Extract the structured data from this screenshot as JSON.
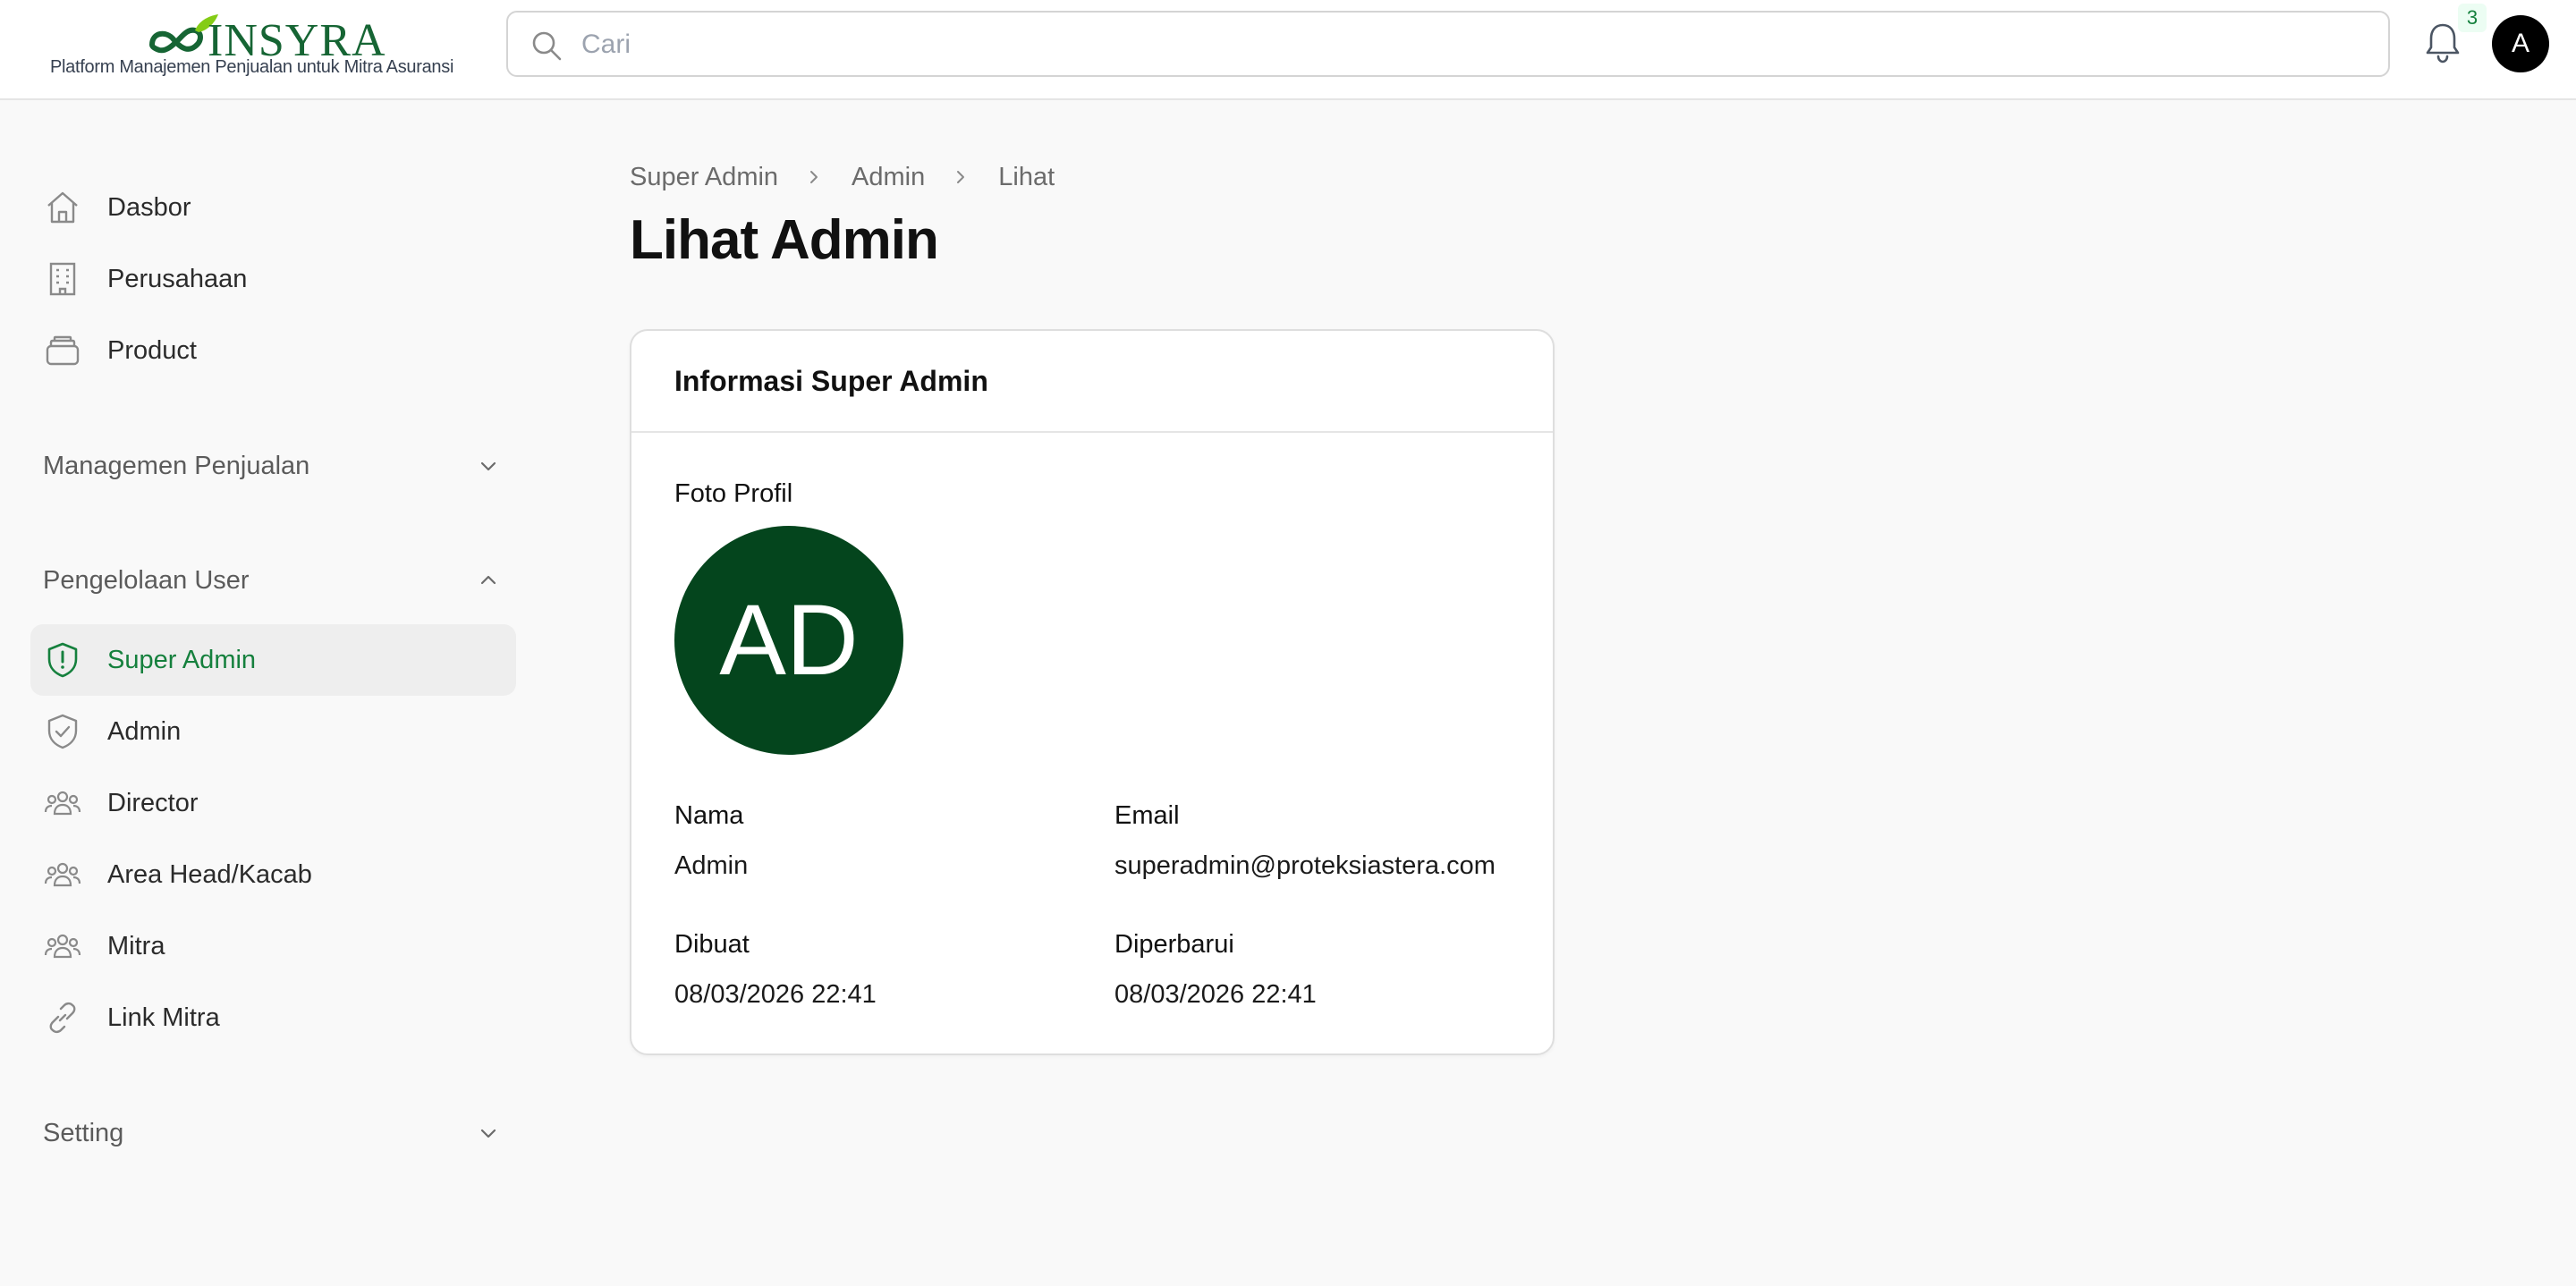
{
  "header": {
    "brand_name": "INSYRA",
    "brand_tagline": "Platform Manajemen Penjualan untuk Mitra Asuransi",
    "search_placeholder": "Cari",
    "notification_count": "3",
    "user_initial": "A",
    "brand_color": "#166534"
  },
  "sidebar": {
    "top_items": [
      {
        "label": "Dasbor",
        "icon": "home-icon"
      },
      {
        "label": "Perusahaan",
        "icon": "building-icon"
      },
      {
        "label": "Product",
        "icon": "layers-icon"
      }
    ],
    "groups": [
      {
        "label": "Managemen Penjualan",
        "expanded": false
      },
      {
        "label": "Pengelolaan User",
        "expanded": true
      },
      {
        "label": "Setting",
        "expanded": false
      }
    ],
    "user_items": [
      {
        "label": "Super Admin",
        "icon": "shield-alert-icon",
        "active": true
      },
      {
        "label": "Admin",
        "icon": "shield-check-icon",
        "active": false
      },
      {
        "label": "Director",
        "icon": "users-icon",
        "active": false
      },
      {
        "label": "Area Head/Kacab",
        "icon": "users-icon",
        "active": false
      },
      {
        "label": "Mitra",
        "icon": "users-icon",
        "active": false
      },
      {
        "label": "Link Mitra",
        "icon": "link-icon",
        "active": false
      }
    ],
    "active_color": "#15803d"
  },
  "breadcrumb": [
    "Super Admin",
    "Admin",
    "Lihat"
  ],
  "page_title": "Lihat Admin",
  "card": {
    "title": "Informasi Super Admin",
    "photo_label": "Foto Profil",
    "avatar_initials": "AD",
    "avatar_color": "#04451d",
    "fields": {
      "name_label": "Nama",
      "name_value": "Admin",
      "email_label": "Email",
      "email_value": "superadmin@proteksiastera.com",
      "created_label": "Dibuat",
      "created_value": "08/03/2026 22:41",
      "updated_label": "Diperbarui",
      "updated_value": "08/03/2026 22:41"
    }
  }
}
